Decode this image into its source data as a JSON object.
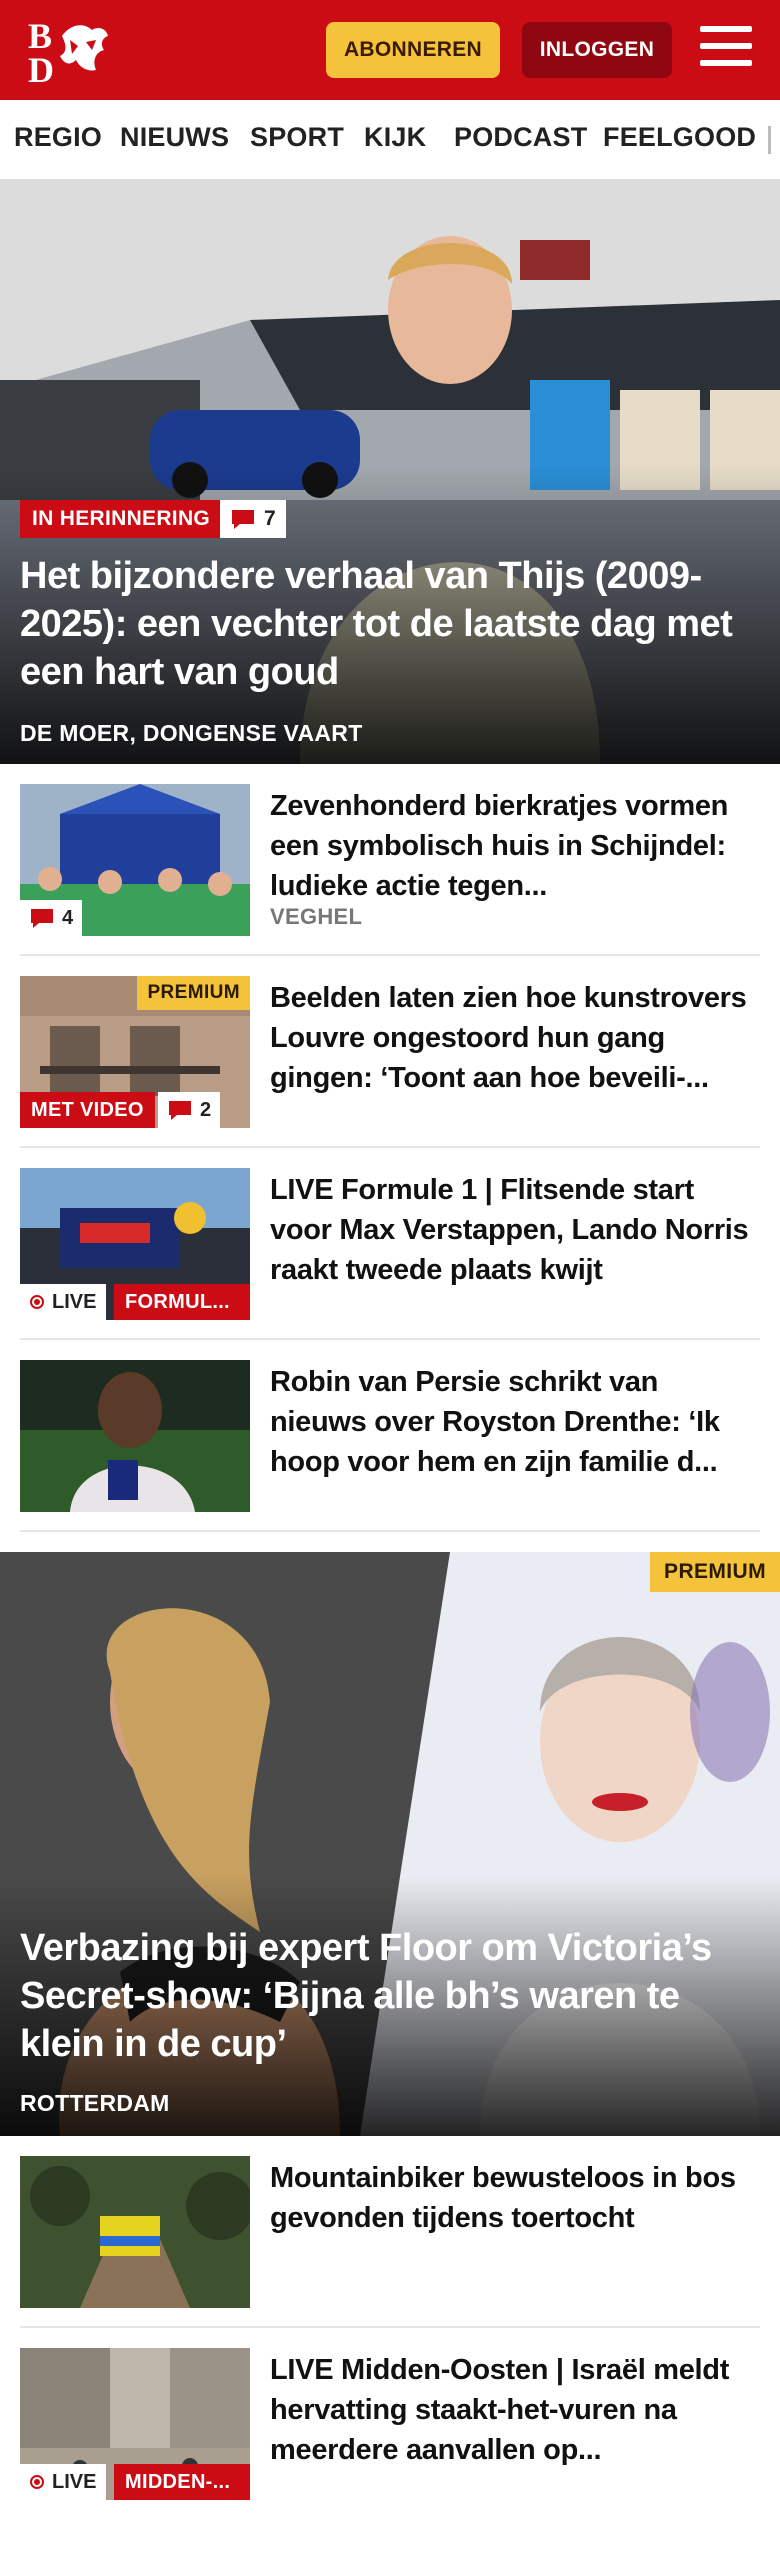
{
  "header": {
    "logo_text": "BD",
    "subscribe_label": "ABONNEREN",
    "login_label": "INLOGGEN",
    "menu_icon": "hamburger-icon",
    "brand_color": "#cc0c15"
  },
  "nav": {
    "items": [
      "REGIO",
      "NIEUWS",
      "SPORT",
      "KIJK",
      "PODCAST",
      "FEELGOOD"
    ]
  },
  "hero": {
    "tag": "IN HERINNERING",
    "comment_count": "7",
    "title": "Het bijzondere verhaal van Thijs (2009-2025): een vechter tot de laatste dag met een hart van goud",
    "location": "DE MOER, DONGENSE VAART"
  },
  "articles": [
    {
      "title": "Zevenhonderd bierkratjes vormen een symbolisch huis in Schijndel: ludieke actie tegen...",
      "location": "VEGHEL",
      "comment_count": "4"
    },
    {
      "title": "Beelden laten zien hoe kunstro­vers Louvre ongestoord hun gang gingen: ‘Toont aan hoe beveili-...",
      "premium": "PREMIUM",
      "video_tag": "MET VIDEO",
      "comment_count": "2"
    },
    {
      "title": "LIVE Formule 1 | Flitsende start voor Max Verstappen, Lando Norris raakt tweede plaats kwijt",
      "live_label": "LIVE",
      "category_tag": "FORMUL..."
    },
    {
      "title": "Robin van Persie schrikt van nieuws over Royston Drenthe: ‘Ik hoop voor hem en zijn familie d..."
    }
  ],
  "feature": {
    "premium": "PREMIUM",
    "title": "Verbazing bij expert Floor om Victoria’s Secret-show: ‘Bijna alle bh’s waren te klein in de cup’",
    "location": "ROTTERDAM"
  },
  "articles2": [
    {
      "title": "Mountainbiker bewusteloos in bos gevonden tijdens toertocht"
    },
    {
      "title": "LIVE Midden-Oosten | Israël meldt hervatting staakt-het-vu­ren na meerdere aanvallen op...",
      "live_label": "LIVE",
      "category_tag": "MIDDEN-..."
    }
  ]
}
